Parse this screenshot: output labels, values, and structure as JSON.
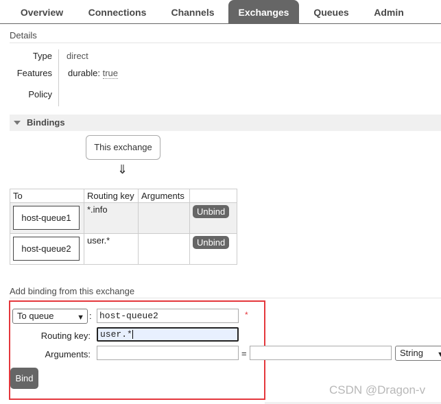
{
  "tabs": [
    {
      "label": "Overview"
    },
    {
      "label": "Connections"
    },
    {
      "label": "Channels"
    },
    {
      "label": "Exchanges",
      "active": true
    },
    {
      "label": "Queues"
    },
    {
      "label": "Admin"
    }
  ],
  "details": {
    "title": "Details",
    "type_label": "Type",
    "type_value": "direct",
    "features_label": "Features",
    "features_key": "durable:",
    "features_value": "true",
    "policy_label": "Policy"
  },
  "bindings": {
    "title": "Bindings",
    "this_exchange": "This exchange",
    "arrow": "⇓",
    "headers": [
      "To",
      "Routing key",
      "Arguments"
    ],
    "rows": [
      {
        "to": "host-queue1",
        "routing_key": "*.info",
        "arguments": "",
        "action": "Unbind"
      },
      {
        "to": "host-queue2",
        "routing_key": "user.*",
        "arguments": "",
        "action": "Unbind"
      }
    ]
  },
  "add_binding": {
    "title": "Add binding from this exchange",
    "destination_type": "To queue",
    "destination_value": "host-queue2",
    "required_marker": "*",
    "routing_key_label": "Routing key:",
    "routing_key_value": "user.*",
    "arguments_label": "Arguments:",
    "arguments_key": "",
    "equals": "=",
    "arguments_value": "",
    "arguments_type": "String",
    "bind_label": "Bind"
  },
  "watermark": "CSDN @Dragon-v",
  "colors": {
    "accent": "#666666",
    "highlight": "#e4363b"
  }
}
